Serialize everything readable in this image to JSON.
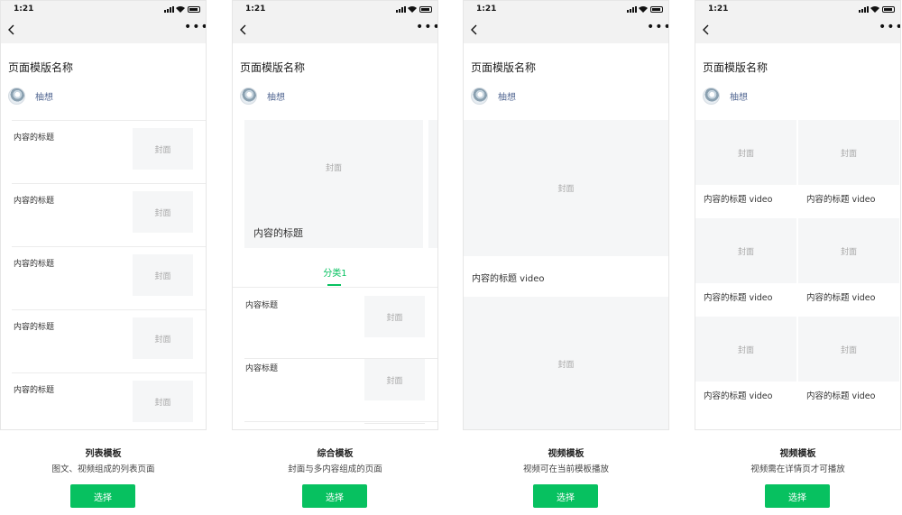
{
  "status": {
    "time": "1:21"
  },
  "templates": [
    {
      "title": "页面模版名称",
      "author": "柚想",
      "rows": [
        {
          "title": "内容的标题",
          "cover": "封面"
        },
        {
          "title": "内容的标题",
          "cover": "封面"
        },
        {
          "title": "内容的标题",
          "cover": "封面"
        },
        {
          "title": "内容的标题",
          "cover": "封面"
        },
        {
          "title": "内容的标题",
          "cover": "封面"
        }
      ],
      "caption": {
        "name": "列表模板",
        "desc": "图文、视频组成的列表页面"
      },
      "select": "选择"
    },
    {
      "title": "页面模版名称",
      "author": "柚想",
      "hero": {
        "cover": "封面",
        "title": "内容的标题"
      },
      "tab": "分类1",
      "rows": [
        {
          "title": "内容标题",
          "cover": "封面"
        },
        {
          "title": "内容标题",
          "cover": "封面"
        }
      ],
      "caption": {
        "name": "综合模板",
        "desc": "封面与多内容组成的页面"
      },
      "select": "选择"
    },
    {
      "title": "页面模版名称",
      "author": "柚想",
      "video": {
        "cover1": "封面",
        "title": "内容的标题 video",
        "cover2": "封面"
      },
      "caption": {
        "name": "视频模板",
        "desc": "视频可在当前模板播放"
      },
      "select": "选择"
    },
    {
      "title": "页面模版名称",
      "author": "柚想",
      "grid": [
        {
          "cover": "封面",
          "title": "内容的标题 video"
        },
        {
          "cover": "封面",
          "title": "内容的标题 video"
        },
        {
          "cover": "封面",
          "title": "内容的标题 video"
        },
        {
          "cover": "封面",
          "title": "内容的标题 video"
        },
        {
          "cover": "封面",
          "title": "内容的标题 video"
        },
        {
          "cover": "封面",
          "title": "内容的标题 video"
        }
      ],
      "caption": {
        "name": "视频模板",
        "desc": "视频需在详情页才可播放"
      },
      "select": "选择"
    }
  ],
  "colors": {
    "accent": "#07c160",
    "link": "#576b95",
    "cover_bg": "#f5f6f7"
  },
  "icons": [
    "back-chevron-icon",
    "more-dots-icon",
    "signal-icon",
    "wifi-icon",
    "battery-icon"
  ]
}
